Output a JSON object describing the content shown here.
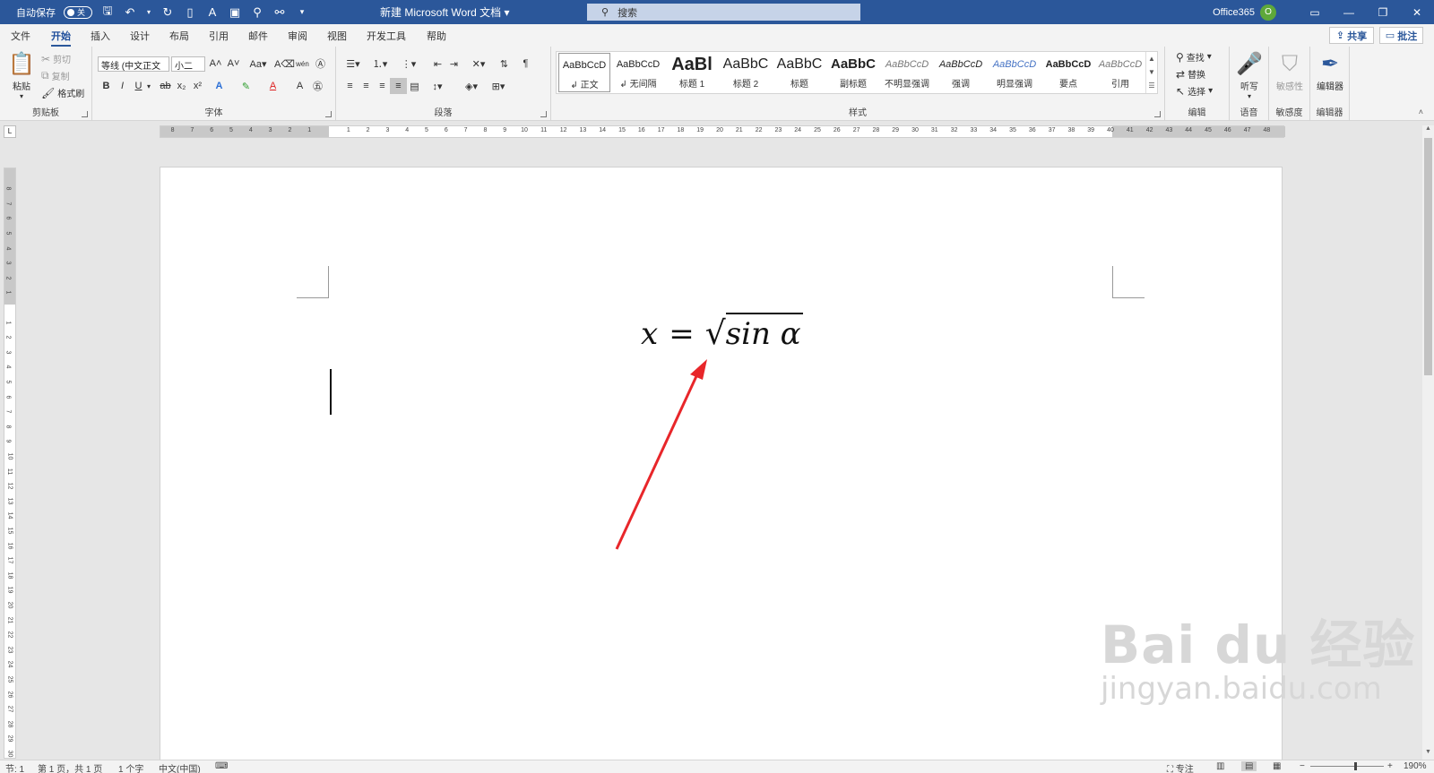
{
  "titlebar": {
    "autosave_label": "自动保存",
    "autosave_state": "关",
    "doc_title": "新建 Microsoft Word 文档 ▾",
    "search_placeholder": "搜索",
    "account_name": "Office365",
    "avatar_initial": "O",
    "quick_access_icons": [
      "save-icon",
      "undo-icon",
      "redo-icon",
      "touch-mode-icon",
      "read-aloud-icon",
      "screenshot-icon",
      "find-icon",
      "org-chart-icon",
      "customize-icon"
    ]
  },
  "tabs": [
    "文件",
    "开始",
    "插入",
    "设计",
    "布局",
    "引用",
    "邮件",
    "审阅",
    "视图",
    "开发工具",
    "帮助"
  ],
  "active_tab": "开始",
  "share_label": "共享",
  "comments_label": "批注",
  "ribbon": {
    "clipboard": {
      "label": "剪贴板",
      "paste": "粘贴",
      "cut": "剪切",
      "copy": "复制",
      "format_painter": "格式刷"
    },
    "font": {
      "label": "字体",
      "font_name": "等线 (中文正文",
      "font_size": "小二"
    },
    "paragraph": {
      "label": "段落"
    },
    "styles": {
      "label": "样式",
      "items": [
        {
          "sample": "AaBbCcD",
          "name": "↲ 正文"
        },
        {
          "sample": "AaBbCcD",
          "name": "↲ 无间隔"
        },
        {
          "sample": "AaBl",
          "name": "标题 1"
        },
        {
          "sample": "AaBbC",
          "name": "标题 2"
        },
        {
          "sample": "AaBbC",
          "name": "标题"
        },
        {
          "sample": "AaBbC",
          "name": "副标题"
        },
        {
          "sample": "AaBbCcD",
          "name": "不明显强调"
        },
        {
          "sample": "AaBbCcD",
          "name": "强调"
        },
        {
          "sample": "AaBbCcD",
          "name": "明显强调"
        },
        {
          "sample": "AaBbCcD",
          "name": "要点"
        },
        {
          "sample": "AaBbCcD",
          "name": "引用"
        }
      ]
    },
    "editing": {
      "label": "编辑",
      "find": "查找",
      "replace": "替换",
      "select": "选择"
    },
    "voice": {
      "label": "语音",
      "dictate": "听写"
    },
    "sensitivity": {
      "label": "敏感度",
      "button": "敏感性"
    },
    "editor": {
      "label": "编辑器",
      "button": "编辑器"
    }
  },
  "document": {
    "equation": {
      "lhs": "x",
      "op": "=",
      "radical": "√",
      "radicand": "sin α"
    }
  },
  "watermark": {
    "main": "Bai du 经验",
    "url": "jingyan.baidu.com"
  },
  "statusbar": {
    "section": "节: 1",
    "page": "第 1 页，共 1 页",
    "words": "1 个字",
    "language": "中文(中国)",
    "focus": "专注",
    "zoom": "190%"
  },
  "colors": {
    "titlebar": "#2b579a",
    "arrow": "#e8262a",
    "ribbon_bg": "#f3f3f3",
    "workspace_bg": "#e6e6e6"
  }
}
